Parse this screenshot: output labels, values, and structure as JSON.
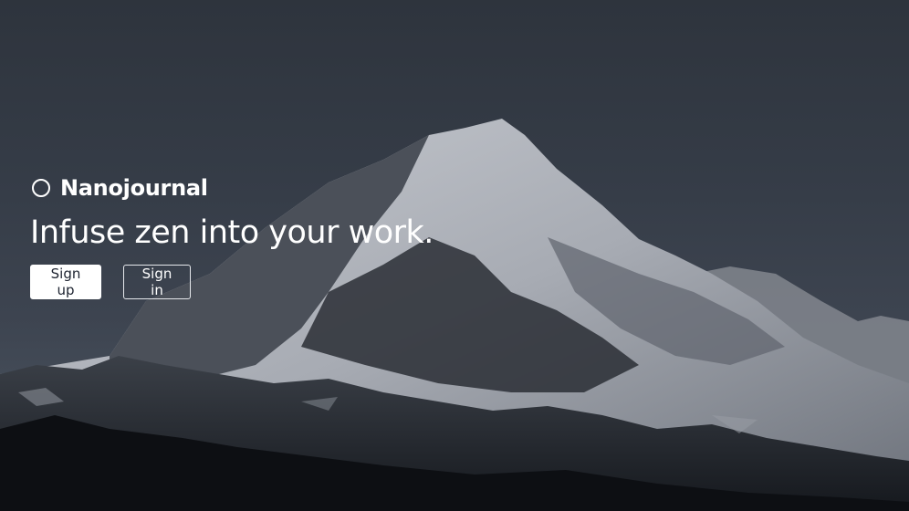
{
  "brand": {
    "icon": "circle-icon",
    "name": "Nanojournal"
  },
  "hero": {
    "headline": "Infuse zen into your work.",
    "background": "mountain-photo"
  },
  "actions": {
    "sign_up_label": "Sign up",
    "sign_in_label": "Sign in"
  },
  "colors": {
    "sky": "#353c47",
    "text": "#ffffff",
    "primary_button_bg": "#ffffff",
    "primary_button_text": "#1d2330"
  }
}
